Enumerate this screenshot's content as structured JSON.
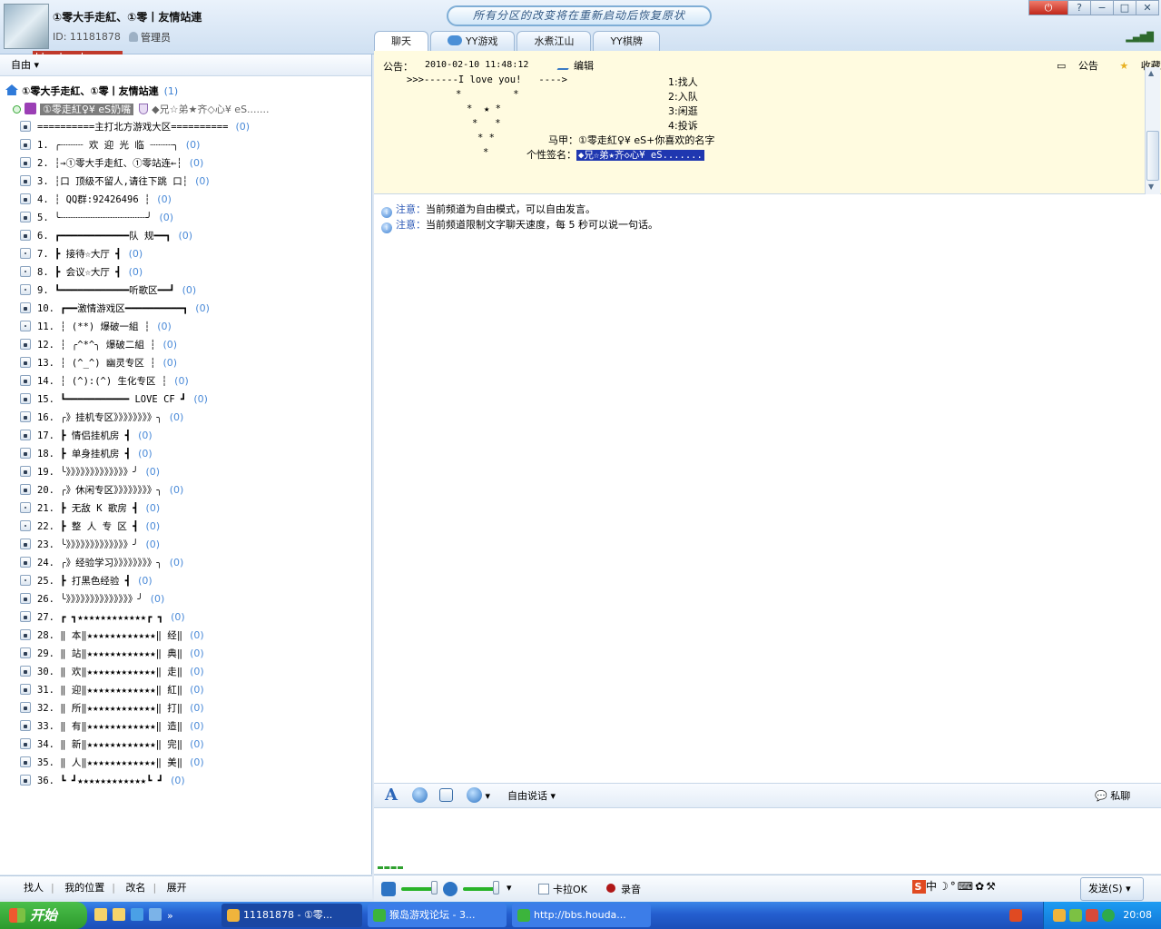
{
  "header": {
    "channel_title": "①零大手走紅、①零丨友情站連",
    "channel_id": "ID: 11181878",
    "role": "管理员",
    "logo_url": "bbs.houdao.com",
    "announcement": "所有分区的改变将在重新启动后恢复原状",
    "window_buttons": [
      "⏻",
      "?",
      "−",
      "□",
      "✕"
    ]
  },
  "tabs": [
    {
      "label": "聊天",
      "active": true
    },
    {
      "label": "YY游戏",
      "active": false
    },
    {
      "label": "水煮江山",
      "active": false
    },
    {
      "label": "YY棋牌",
      "active": false
    }
  ],
  "left": {
    "mode_label": "自由",
    "channel_name": "①零大手走紅、①零丨友情站連",
    "channel_count": "(1)",
    "user": {
      "name": "①零走紅♀¥ eS奶嘴",
      "signature": "◆兄☆弟★齐◇心¥ eS......."
    },
    "rooms": [
      {
        "name": "==========主打北方游戏大区==========",
        "count": "(0)",
        "open": false
      },
      {
        "name": "1. ╭┈┈┈┈  欢 迎 光 临 ┈┈┈┈╮",
        "count": "(0)",
        "open": false
      },
      {
        "name": "2. ┆→①零大手走紅、①零站连←┆",
        "count": "(0)",
        "open": false
      },
      {
        "name": "3. ┆口  顶级不留人,请往下跳 口┆",
        "count": "(0)",
        "open": false
      },
      {
        "name": "4. ┆         QQ群:92426496       ┆",
        "count": "(0)",
        "open": false
      },
      {
        "name": "5. ╰┈┈┈┈┈┈┈┈┈┈┈┈┈┈┈╯",
        "count": "(0)",
        "open": false
      },
      {
        "name": "6. ┏━━━━━━━━━━━━队  规━━┓",
        "count": "(0)",
        "open": false
      },
      {
        "name": "7. ┣    接待☆大厅          ┫",
        "count": "(0)",
        "open": true
      },
      {
        "name": "8. ┣    会议☆大厅          ┫",
        "count": "(0)",
        "open": true
      },
      {
        "name": "9. ┗━━━━━━━━━━━━听歌区━━┛",
        "count": "(0)",
        "open": true
      },
      {
        "name": "10. ┏━━激情游戏区━━━━━━━━━━┓",
        "count": "(0)",
        "open": false
      },
      {
        "name": "11. ┆       (**)       爆破一組   ┆",
        "count": "(0)",
        "open": true
      },
      {
        "name": "12. ┆ ╭^*^╮          爆破二組   ┆",
        "count": "(0)",
        "open": false
      },
      {
        "name": "13. ┆ (^_^)          幽灵专区   ┆",
        "count": "(0)",
        "open": false
      },
      {
        "name": "14. ┆ (^):(^)        生化专区   ┆",
        "count": "(0)",
        "open": false
      },
      {
        "name": "15. ┗━━━━━━━━━━━ LOVE  CF ┛",
        "count": "(0)",
        "open": false
      },
      {
        "name": "16. ╭》挂机专区》》》》》》》》╮",
        "count": "(0)",
        "open": false
      },
      {
        "name": "17. ┣            情侣挂机房  ┫",
        "count": "(0)",
        "open": false
      },
      {
        "name": "18. ┣            单身挂机房  ┫",
        "count": "(0)",
        "open": false
      },
      {
        "name": "19. ╰》》》》》》》》》》》》》╯",
        "count": "(0)",
        "open": false
      },
      {
        "name": "20. ╭》休闲专区》》》》》》》》╮",
        "count": "(0)",
        "open": false
      },
      {
        "name": "21. ┣            无敌 K 歌房  ┫",
        "count": "(0)",
        "open": true
      },
      {
        "name": "22. ┣            整 人 专 区  ┫",
        "count": "(0)",
        "open": true
      },
      {
        "name": "23. ╰》》》》》》》》》》》》》╯",
        "count": "(0)",
        "open": false
      },
      {
        "name": "24. ╭》经验学习》》》》》》》》╮",
        "count": "(0)",
        "open": false
      },
      {
        "name": "25. ┣            打黑色经验  ┫",
        "count": "(0)",
        "open": true
      },
      {
        "name": "26. ╰》》》》》》》》》》》》》》╯",
        "count": "(0)",
        "open": false
      },
      {
        "name": "27. ┏    ┓★★★★★★★★★★★★┏    ┓",
        "count": "(0)",
        "open": false
      },
      {
        "name": "28. ‖ 本‖★★★★★★★★★★★★‖ 经‖",
        "count": "(0)",
        "open": false
      },
      {
        "name": "29. ‖ 站‖★★★★★★★★★★★★‖ 典‖",
        "count": "(0)",
        "open": false
      },
      {
        "name": "30. ‖ 欢‖★★★★★★★★★★★★‖ 走‖",
        "count": "(0)",
        "open": false
      },
      {
        "name": "31. ‖ 迎‖★★★★★★★★★★★★‖ 紅‖",
        "count": "(0)",
        "open": false
      },
      {
        "name": "32. ‖ 所‖★★★★★★★★★★★★‖ 打‖",
        "count": "(0)",
        "open": false
      },
      {
        "name": "33. ‖ 有‖★★★★★★★★★★★★‖ 造‖",
        "count": "(0)",
        "open": false
      },
      {
        "name": "34. ‖ 新‖★★★★★★★★★★★★‖ 完‖",
        "count": "(0)",
        "open": false
      },
      {
        "name": "35. ‖ 人‖★★★★★★★★★★★★‖ 美‖",
        "count": "(0)",
        "open": false
      },
      {
        "name": "36. ┗    ┛★★★★★★★★★★★★┗    ┛",
        "count": "(0)",
        "open": false
      }
    ],
    "bottom": {
      "find": "找人",
      "position": "我的位置",
      "rename": "改名",
      "expand": "展开"
    }
  },
  "notice": {
    "label": "公告：",
    "date": "2010-02-10 11:48:12",
    "edit": "编辑",
    "announce": "公告",
    "favorite": "收藏",
    "art": [
      ">>>------I love you!   ---->",
      "*         *",
      "*  ★ *",
      "*   *",
      "* *",
      "*"
    ],
    "menu": [
      "1:找人",
      "2:入队",
      "3:闲逛",
      "4:投诉"
    ],
    "vest_label": "马甲：",
    "vest_value": "①零走紅♀¥ eS+你喜欢的名字",
    "sig_label": "个性签名：",
    "sig_value": "◆兄☆弟★齐◇心¥ eS......."
  },
  "chat": {
    "messages": [
      {
        "label": "注意：",
        "text": "当前频道为自由模式，可以自由发言。"
      },
      {
        "label": "注意：",
        "text": "当前频道限制文字聊天速度，每 5 秒可以说一句话。"
      }
    ]
  },
  "toolbar": {
    "mode": "自由说话",
    "private": "私聊"
  },
  "bottom": {
    "karaoke": "卡拉OK",
    "record": "录音",
    "send": "发送(S)",
    "ime": "中"
  },
  "taskbar": {
    "start": "开始",
    "tasks": [
      "11181878 - ①零...",
      "猴岛游戏论坛 - 3...",
      "http://bbs.houda..."
    ],
    "clock": "20:08"
  }
}
